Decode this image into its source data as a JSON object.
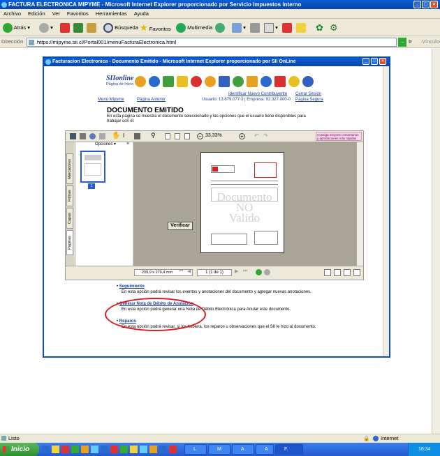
{
  "window": {
    "title": "FACTURA ELECTRONICA MIPYME - Microsoft Internet Explorer proporcionado por Servicio Impuestos Interno"
  },
  "menu": [
    "Archivo",
    "Edición",
    "Ver",
    "Favoritos",
    "Herramientas",
    "Ayuda"
  ],
  "toolbar": {
    "back": "Atrás",
    "search": "Búsqueda",
    "favorites": "Favoritos",
    "multimedia": "Multimedia"
  },
  "address": {
    "label": "Dirección",
    "url": "https://mipyme.sii.cl/Portal001/menuFacturaElectronica.html",
    "go": "Ir",
    "links": "Vínculos"
  },
  "status": {
    "text": "Listo",
    "zone": "Internet"
  },
  "taskbar": {
    "start": "Inicio",
    "clock": "16:34",
    "tasks": [
      "L",
      "M",
      "A",
      "A",
      "F."
    ]
  },
  "inner": {
    "title": "Facturacion Electronica - Documento Emitido - Microsoft Internet Explorer proporcionado por SII OnLine",
    "logo": {
      "brand": "SIIonline",
      "sub": "Página de Inicio"
    },
    "links": {
      "identify": "Identificar Nuevo Contribuyente",
      "close": "Cerrar Sesión",
      "menu": "Menú Mipyme",
      "prev": "Página Anterior",
      "secure": "Página Segura"
    },
    "user": "Usuario: 13.679.077-3 | Empresa: 92.327.000-0",
    "heading": "DOCUMENTO EMITIDO",
    "intro": "En esta página se muestra el documento seleccionado y las opciones que el usuario tiene disponibles para trabajar con él.",
    "viewer": {
      "zoom": "33,33%",
      "options": "Opciones",
      "page_nav": "1 (1 de 1)",
      "page_size": "209,9 x 279,4 mm",
      "promo": "Consiga mejores comentarios y aprobaciones más rápidas",
      "tabs": [
        "Marcadores",
        "Firmas",
        "Capas",
        "Páginas"
      ],
      "thumb_num": "1",
      "watermark": [
        "Documento",
        "NO",
        "Valido"
      ]
    },
    "verify": "Verificar",
    "options": [
      {
        "title": "Seguimiento",
        "desc": "En esta opción podrá revisar los eventos y anotaciones del documento y agregar nuevas anotaciones."
      },
      {
        "title": "Generar Nota de Débito de Anulación",
        "desc": "En esta opción podrá generar una Nota de Débito Electrónica para Anular este documento."
      },
      {
        "title": "Reparos",
        "desc": "En esta opción podrá revisar, si los hubiera, los reparos u observaciones que el SII le hizo al documento."
      }
    ]
  }
}
